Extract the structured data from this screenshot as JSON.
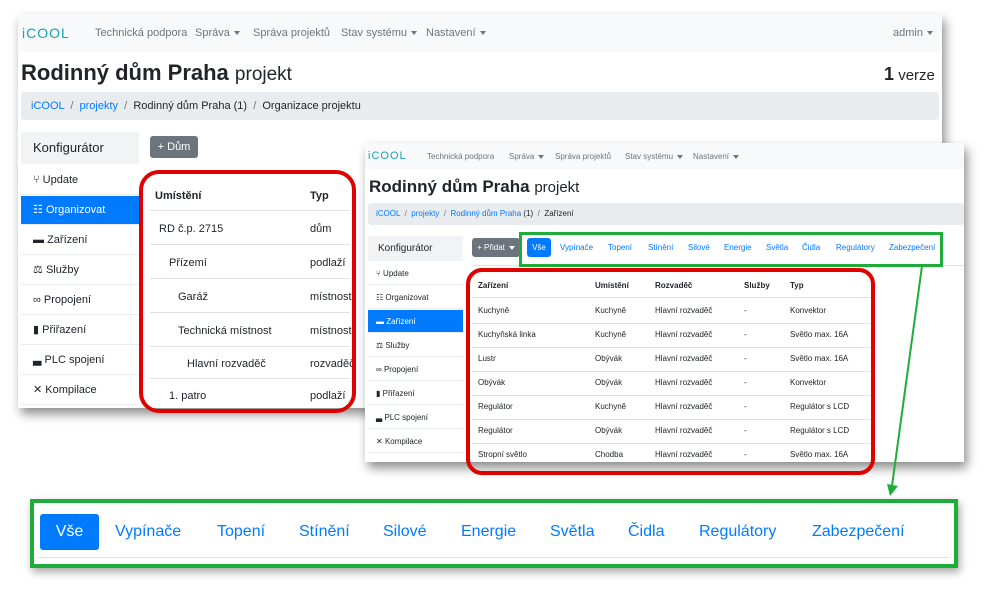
{
  "brand": "iCOOL",
  "nav": {
    "support": "Technická podpora",
    "admin_menu": "Správa",
    "projects": "Správa projektů",
    "system": "Stav systému",
    "settings": "Nastavení",
    "user": "admin"
  },
  "project": {
    "title": "Rodinný dům Praha",
    "suffix": "projekt",
    "versions_count": "1",
    "versions_label": "verze"
  },
  "back": {
    "breadcrumb": {
      "home": "iCOOL",
      "projects": "projekty",
      "project": "Rodinný dům Praha (1)",
      "current": "Organizace projektu"
    },
    "add_button": "Dům",
    "table": {
      "col_location": "Umístění",
      "col_type": "Typ",
      "rows": [
        {
          "location": "RD č.p. 2715",
          "type": "dům"
        },
        {
          "location": "Přízemí",
          "type": "podlaží"
        },
        {
          "location": "Garáž",
          "type": "místnost"
        },
        {
          "location": "Technická místnost",
          "type": "místnost"
        },
        {
          "location": "Hlavní rozvaděč",
          "type": "rozvaděč"
        },
        {
          "location": "1. patro",
          "type": "podlaží"
        }
      ]
    }
  },
  "sidebar": {
    "title": "Konfigurátor",
    "items": [
      {
        "label": "Update",
        "icon": "branch-icon"
      },
      {
        "label": "Organizovat",
        "icon": "sitemap-icon"
      },
      {
        "label": "Zařízení",
        "icon": "device-icon"
      },
      {
        "label": "Služby",
        "icon": "scale-icon"
      },
      {
        "label": "Propojení",
        "icon": "link-icon"
      },
      {
        "label": "Přiřazení",
        "icon": "book-icon"
      },
      {
        "label": "PLC spojení",
        "icon": "car-icon"
      },
      {
        "label": "Kompilace",
        "icon": "compress-icon"
      }
    ]
  },
  "front": {
    "breadcrumb": {
      "home": "iCOOL",
      "projects": "projekty",
      "project": "Rodinný dům Praha",
      "version": "(1)",
      "current": "Zařízení"
    },
    "add_button": "Přidat",
    "table": {
      "headers": [
        "Zařízení",
        "Umístění",
        "Rozvaděč",
        "Služby",
        "Typ"
      ],
      "rows": [
        [
          "Kuchyně",
          "Kuchyně",
          "Hlavní rozvaděč",
          "-",
          "Konvektor"
        ],
        [
          "Kuchyňská linka",
          "Kuchyně",
          "Hlavní rozvaděč",
          "-",
          "Světlo max. 16A"
        ],
        [
          "Lustr",
          "Obývák",
          "Hlavní rozvaděč",
          "-",
          "Světlo max. 16A"
        ],
        [
          "Obývák",
          "Obývák",
          "Hlavní rozvaděč",
          "-",
          "Konvektor"
        ],
        [
          "Regulátor",
          "Kuchyně",
          "Hlavní rozvaděč",
          "-",
          "Regulátor s LCD"
        ],
        [
          "Regulátor",
          "Obývák",
          "Hlavní rozvaděč",
          "-",
          "Regulátor s LCD"
        ],
        [
          "Stropní světlo",
          "Chodba",
          "Hlavní rozvaděč",
          "-",
          "Světlo max. 16A"
        ]
      ]
    }
  },
  "tabs": [
    "Vše",
    "Vypínače",
    "Topení",
    "Stínění",
    "Silové",
    "Energie",
    "Světla",
    "Čidla",
    "Regulátory",
    "Zabezpečení"
  ],
  "colors": {
    "accent": "#007bff",
    "highlight_red": "#e00000",
    "highlight_green": "#1fad3a"
  }
}
